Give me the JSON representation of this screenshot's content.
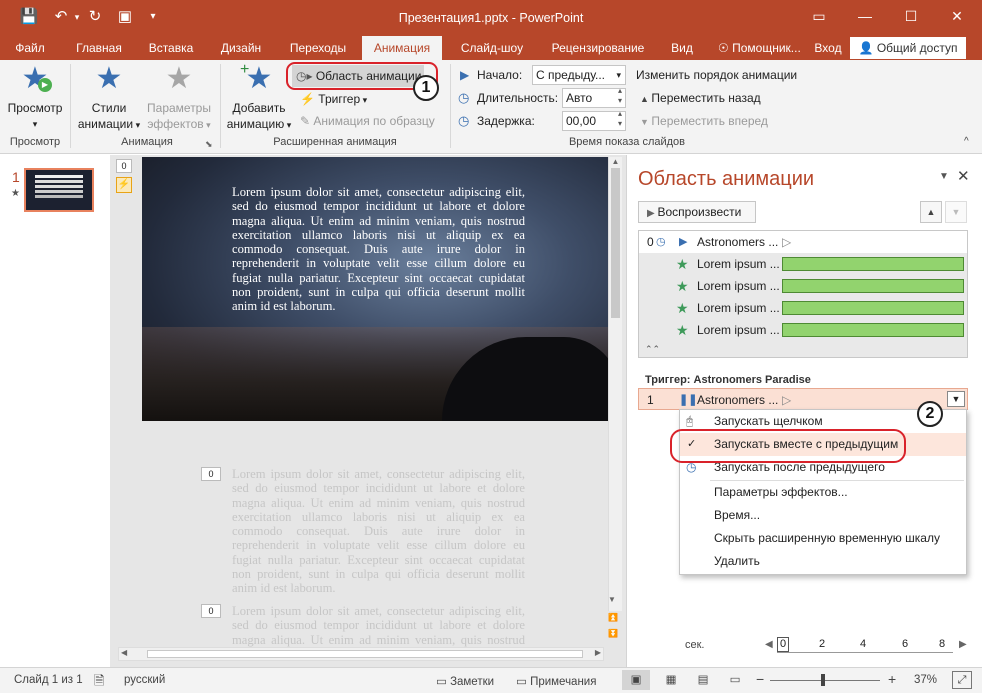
{
  "window": {
    "title": "Презентация1.pptx - PowerPoint",
    "controls": [
      "▭",
      "—",
      "☐",
      "✕"
    ]
  },
  "tabs": {
    "file": "Файл",
    "home": "Главная",
    "insert": "Вставка",
    "design": "Дизайн",
    "transitions": "Переходы",
    "animations": "Анимация",
    "slideshow": "Слайд-шоу",
    "review": "Рецензирование",
    "view": "Вид",
    "tellme": "Помощник...",
    "signin": "Вход",
    "share": "Общий доступ"
  },
  "ribbon": {
    "preview": {
      "label": "Просмотр",
      "group": "Просмотр"
    },
    "animation_styles": {
      "line1": "Стили",
      "line2": "анимации"
    },
    "effect_options": {
      "line1": "Параметры",
      "line2": "эффектов"
    },
    "animation_group": "Анимация",
    "add_animation": {
      "line1": "Добавить",
      "line2": "анимацию"
    },
    "animation_pane": "Область анимации",
    "trigger": "Триггер",
    "animation_painter": "Анимация по образцу",
    "advanced_group": "Расширенная анимация",
    "start_label": "Начало:",
    "start_value": "С предыду...",
    "duration_label": "Длительность:",
    "duration_value": "Авто",
    "delay_label": "Задержка:",
    "delay_value": "00,00",
    "reorder_title": "Изменить порядок анимации",
    "move_earlier": "Переместить назад",
    "move_later": "Переместить вперед",
    "timing_group": "Время показа слайдов"
  },
  "thumbnails": {
    "slide_number": "1",
    "star": "★"
  },
  "editor": {
    "tags": [
      "0",
      "0",
      "0"
    ],
    "lorem": "Lorem ipsum dolor sit amet, consectetur adipiscing elit, sed do eiusmod tempor incididunt ut labore et dolore magna aliqua. Ut enim ad minim veniam, quis nostrud exercitation ullamco laboris nisi ut aliquip ex ea commodo consequat. Duis aute irure dolor in reprehenderit in voluptate velit esse cillum dolore eu fugiat nulla pariatur. Excepteur sint occaecat cupidatat non proident, sunt in culpa qui officia deserunt mollit anim id est laborum."
  },
  "animation_pane": {
    "title": "Область анимации",
    "play_button": "Воспроизвести",
    "main_item": {
      "number": "0",
      "label": "Astronomers ..."
    },
    "sub_items": [
      {
        "label": "Lorem ipsum ..."
      },
      {
        "label": "Lorem ipsum ..."
      },
      {
        "label": "Lorem ipsum ..."
      },
      {
        "label": "Lorem ipsum ..."
      }
    ],
    "trigger_header": "Триггер: Astronomers Paradise",
    "trigger_item": {
      "number": "1",
      "label": "Astronomers ..."
    },
    "seconds_label": "сек.",
    "timeline_ticks": [
      "0",
      "2",
      "4",
      "6",
      "8"
    ]
  },
  "context_menu": {
    "items": [
      "Запускать щелчком",
      "Запускать вместе с предыдущим",
      "Запускать после предыдущего",
      "Параметры эффектов...",
      "Время...",
      "Скрыть расширенную временную шкалу",
      "Удалить"
    ]
  },
  "callouts": {
    "one": "1",
    "two": "2"
  },
  "statusbar": {
    "slide": "Слайд 1 из 1",
    "language": "русский",
    "notes": "Заметки",
    "comments": "Примечания",
    "zoom": "37%"
  },
  "colors": {
    "brand": "#b7472a",
    "bar": "#92d36e",
    "accent": "#3a6fb0",
    "highlight": "#d9222a"
  }
}
